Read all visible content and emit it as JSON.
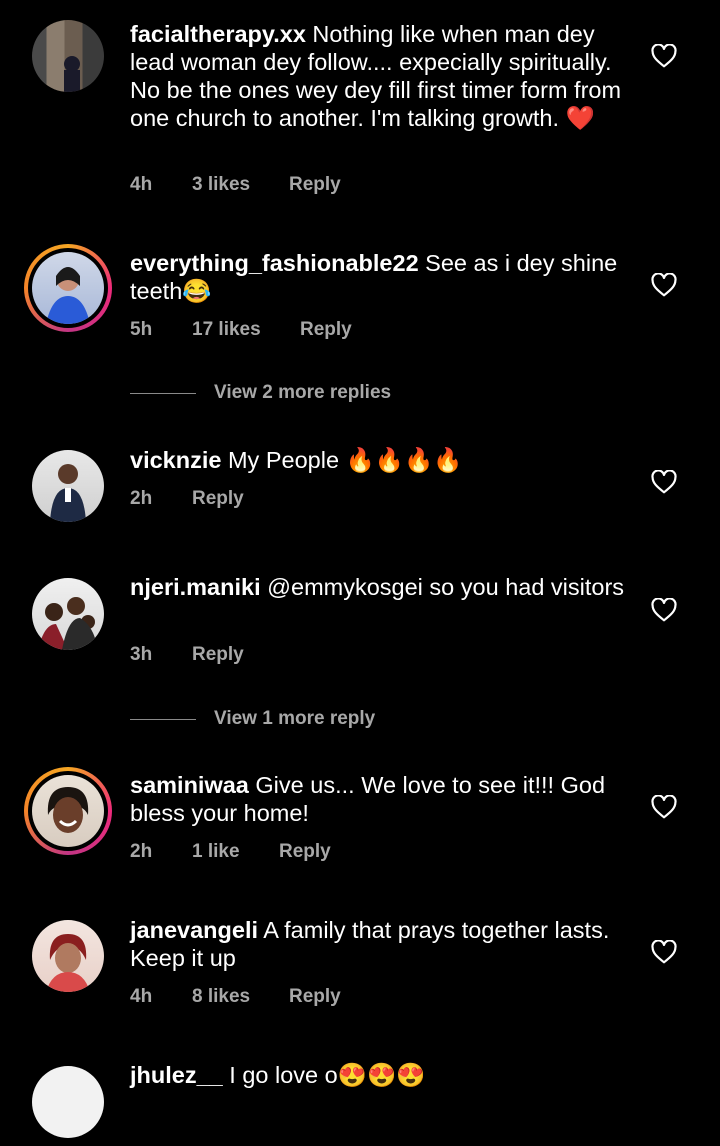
{
  "comments": [
    {
      "user": "facialtherapy.xx",
      "text": " Nothing like when man dey lead woman dey follow.... expecially spiritually. No be the ones wey dey fill first timer form from one church to another. I'm talking growth. ❤️",
      "time": "4h",
      "likes": "3 likes",
      "reply": "Reply"
    },
    {
      "user": "everything_fashionable22",
      "text": " See as i dey shine teeth😂",
      "time": "5h",
      "likes": "17 likes",
      "reply": "Reply"
    },
    {
      "user": "vicknzie",
      "text": " My People 🔥🔥🔥🔥",
      "time": "2h",
      "reply": "Reply"
    },
    {
      "user": "njeri.maniki",
      "text": " @emmykosgei  so you had visitors",
      "time": "3h",
      "reply": "Reply"
    },
    {
      "user": "saminiwaa",
      "text": " Give us... We love to see it!!! God bless your home!",
      "time": "2h",
      "likes": "1 like",
      "reply": "Reply"
    },
    {
      "user": "janevangeli",
      "text": " A family that prays together lasts. Keep it up",
      "time": "4h",
      "likes": "8 likes",
      "reply": "Reply"
    },
    {
      "user": "jhulez__",
      "text": " I go love o😍😍😍"
    }
  ],
  "view_more": [
    "View 2 more replies",
    "View 1 more reply"
  ],
  "colors": {
    "background": "#000000",
    "text": "#ffffff",
    "muted": "#a8a8a8",
    "heart_emoji": "#e0245e",
    "story_ring": "#ee2a7b"
  },
  "icons": {
    "like": "heart-outline-icon"
  }
}
